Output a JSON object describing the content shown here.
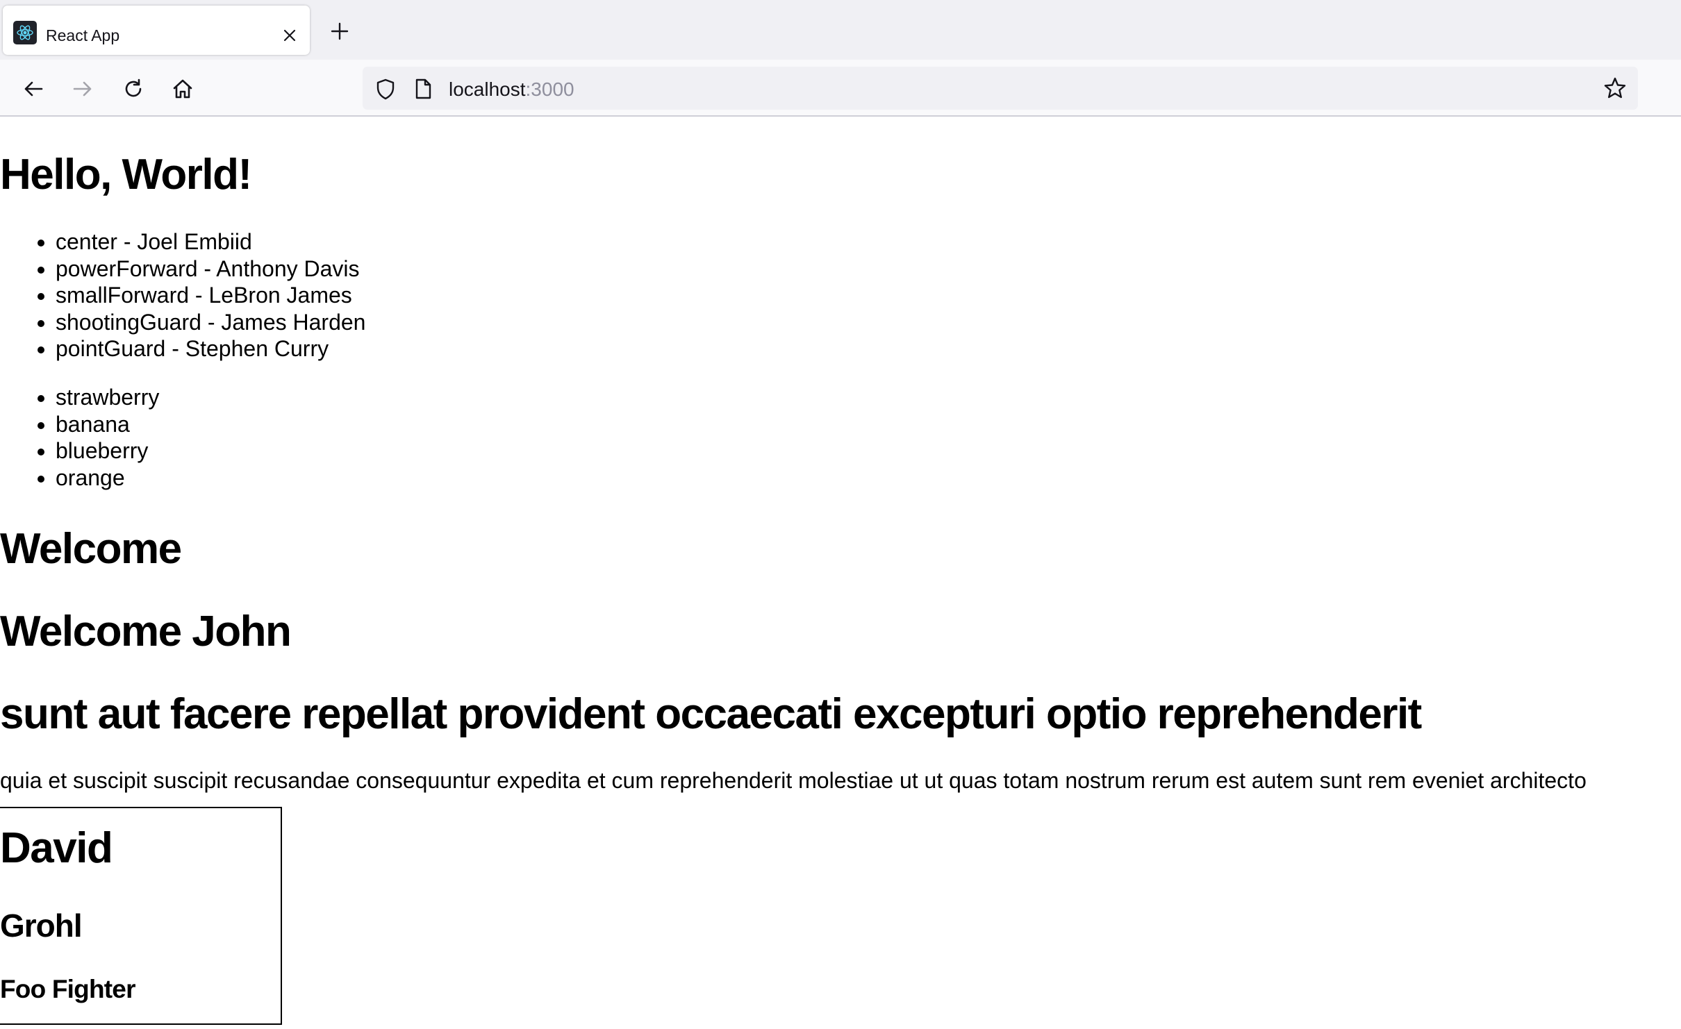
{
  "browser": {
    "tab": {
      "title": "React App",
      "favicon": "react-logo-icon"
    },
    "url": {
      "host": "localhost",
      "port": ":3000"
    },
    "icons": {
      "back": "arrow-left-icon",
      "forward": "arrow-right-icon",
      "reload": "reload-icon",
      "home": "home-icon",
      "tracking_protection": "shield-icon",
      "page_info": "page-icon",
      "bookmark": "star-icon",
      "new_tab": "plus-icon",
      "close_tab": "close-icon"
    }
  },
  "page": {
    "heading": "Hello, World!",
    "players": [
      "center - Joel Embiid",
      "powerForward - Anthony Davis",
      "smallForward - LeBron James",
      "shootingGuard - James Harden",
      "pointGuard - Stephen Curry"
    ],
    "fruits": [
      "strawberry",
      "banana",
      "blueberry",
      "orange"
    ],
    "welcome": "Welcome",
    "welcome_user": "Welcome John",
    "post": {
      "title": "sunt aut facere repellat provident occaecati excepturi optio reprehenderit",
      "body": "quia et suscipit suscipit recusandae consequuntur expedita et cum reprehenderit molestiae ut ut quas totam nostrum rerum est autem sunt rem eveniet architecto"
    },
    "card": {
      "first_name": "David",
      "last_name": "Grohl",
      "band": "Foo Fighter"
    }
  },
  "colors": {
    "tabbar_bg": "#f0f0f4",
    "navbar_bg": "#f9f9fb",
    "url_port": "#8f8f9d",
    "react_blue": "#61dafb"
  }
}
